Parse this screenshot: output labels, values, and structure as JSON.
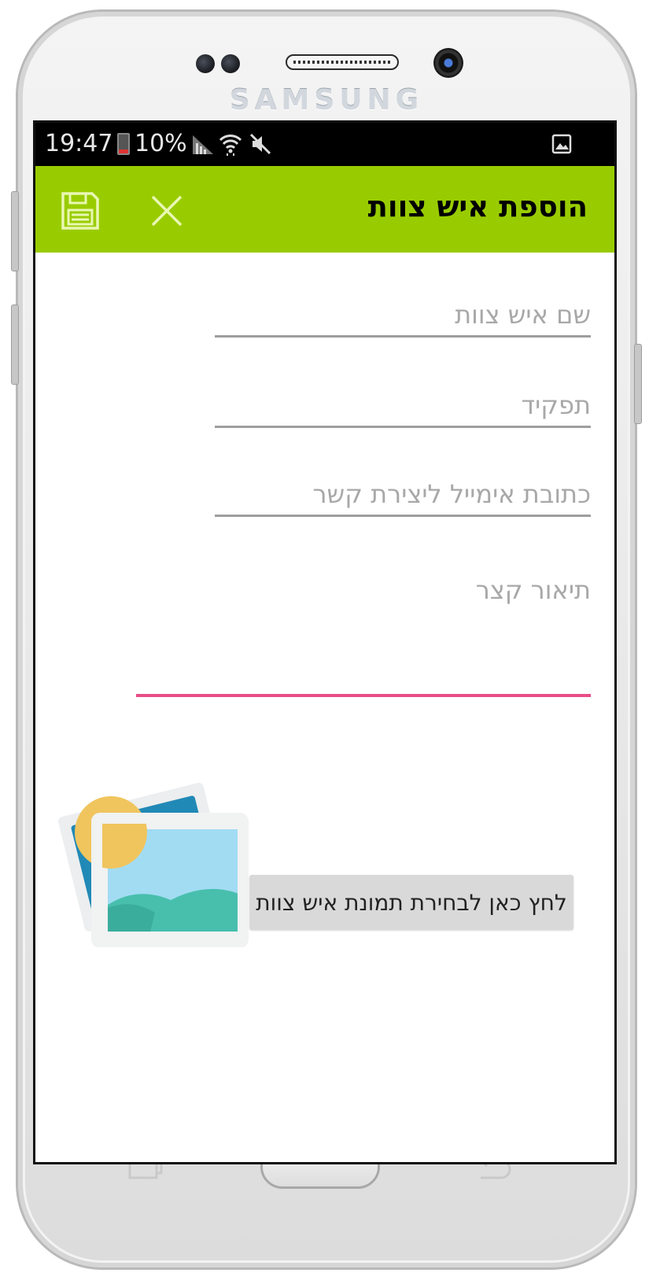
{
  "device": {
    "brand": "SAMSUNG"
  },
  "statusbar": {
    "time": "19:47",
    "battery": "10%",
    "icons": [
      "battery-charging-icon",
      "signal-icon",
      "wifi-icon",
      "mute-icon",
      "gallery-notification-icon"
    ]
  },
  "appbar": {
    "title": "הוספת איש צוות",
    "save_icon": "floppy-disk-icon",
    "close_icon": "close-icon",
    "color": "#99cc00"
  },
  "form": {
    "name_placeholder": "שם איש צוות",
    "role_placeholder": "תפקיד",
    "email_placeholder": "כתובת אימייל ליצירת קשר",
    "description_placeholder": "תיאור קצר",
    "focus_color": "#e84d87"
  },
  "image_picker": {
    "button_label": "לחץ כאן לבחירת תמונת איש צוות",
    "icon": "gallery-photo-icon"
  },
  "navbar": {
    "icons": [
      "recent-apps-icon",
      "home-button",
      "back-icon"
    ]
  }
}
